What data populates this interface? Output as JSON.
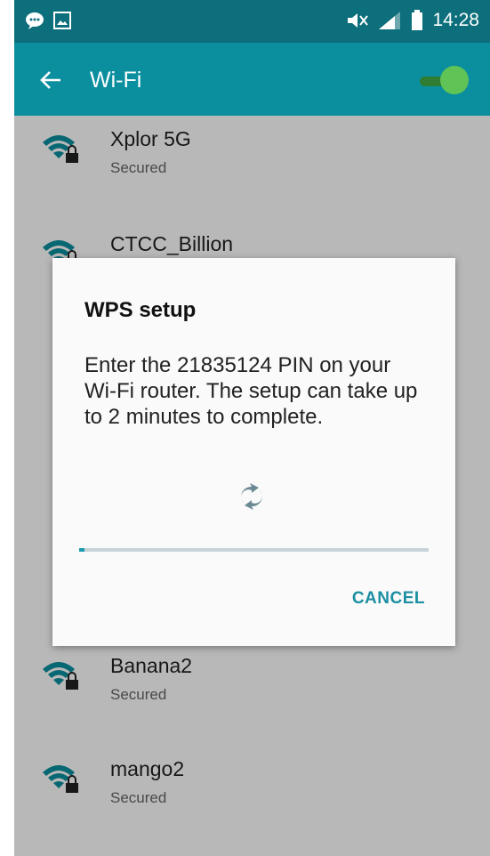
{
  "status_bar": {
    "time": "14:28",
    "icons": [
      "chat-bubble-icon",
      "image-icon",
      "mute-icon",
      "signal-icon",
      "battery-icon"
    ]
  },
  "app_bar": {
    "title": "Wi-Fi",
    "back_icon": "arrow-left-icon",
    "wifi_toggle_on": true
  },
  "networks": [
    {
      "name": "Xplor 5G",
      "status": "Secured",
      "icon": "wifi-lock-icon"
    },
    {
      "name": "CTCC_Billion",
      "status": "",
      "icon": "wifi-lock-icon"
    },
    {
      "name": "Banana2",
      "status": "Secured",
      "icon": "wifi-lock-icon"
    },
    {
      "name": "mango2",
      "status": "Secured",
      "icon": "wifi-lock-icon"
    }
  ],
  "dialog": {
    "title": "WPS setup",
    "message": "Enter the 21835124 PIN on your Wi-Fi router. The setup can take up to 2 minutes to complete.",
    "progress_fraction": 0.015,
    "cancel_label": "CANCEL",
    "spinner_icon": "refresh-icon"
  },
  "colors": {
    "status_bar": "#0c6f7b",
    "app_bar": "#0b8f9f",
    "toggle_on": "#5fc356",
    "accent": "#1c8fa3",
    "wifi_icon": "#0b8f9f"
  }
}
